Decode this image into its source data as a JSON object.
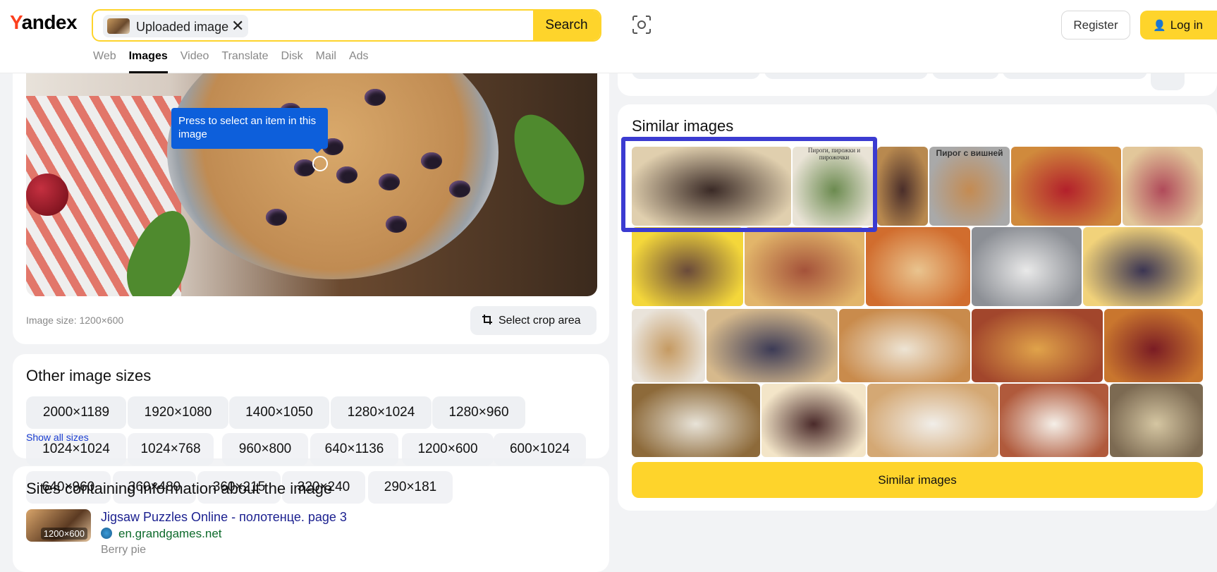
{
  "header": {
    "logo": "Yandex",
    "search_chip_label": "Uploaded image",
    "search_chip_close": "✕",
    "search_button": "Search",
    "register": "Register",
    "login": "Log in",
    "nav": [
      "Web",
      "Images",
      "Video",
      "Translate",
      "Disk",
      "Mail",
      "Ads"
    ],
    "active_nav": "Images"
  },
  "preview": {
    "tooltip": "Press to select an item in this image",
    "image_size": "Image size: 1200×600",
    "crop_button": "Select crop area"
  },
  "other_sizes": {
    "title": "Other image sizes",
    "row1": [
      "2000×1189",
      "1920×1080",
      "1400×1050",
      "1280×1024",
      "1280×960"
    ],
    "row2": [
      "1024×1024",
      "1024×768",
      "960×800",
      "640×1136",
      "1200×600",
      "600×1024"
    ],
    "row3": [
      "640×960",
      "360×480",
      "360×215",
      "320×240",
      "290×181"
    ],
    "show_all": "Show all sizes"
  },
  "sites": {
    "title": "Sites containing information about the image",
    "items": [
      {
        "thumb_size": "1200×600",
        "title": "Jigsaw Puzzles Online - полотенце. page 3",
        "domain": "en.grandgames.net",
        "desc": "Berry pie"
      }
    ]
  },
  "similar": {
    "title": "Similar images",
    "button": "Similar images",
    "thumb2_caption": "Пироги, пирожки и пирожочки",
    "thumb4_caption": "Пирог с вишней"
  },
  "colors": {
    "accent_yellow": "#fed42b",
    "highlight_blue": "#3b3bd1",
    "tooltip_blue": "#0d5fdb",
    "link_blue": "#1a1f8f",
    "domain_green": "#0d6a2b"
  }
}
